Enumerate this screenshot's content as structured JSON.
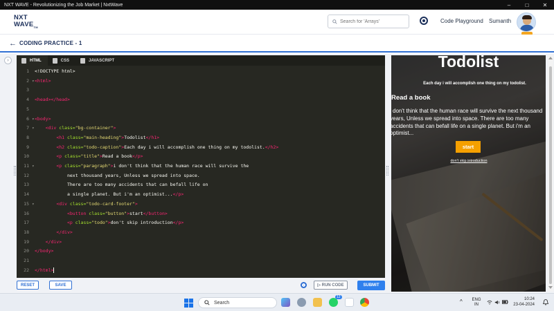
{
  "window": {
    "title": "NXT WAVE - Revolutionizing the Job Market | NxtWave",
    "controls": [
      "–",
      "□",
      "✕"
    ]
  },
  "nav": {
    "logo_line1": "NXT",
    "logo_line2": "WAVE",
    "logo_tm": "TM",
    "search_placeholder": "Search for 'Arrays'",
    "code_playground": "Code Playground",
    "user_name": "Sumanth"
  },
  "header": {
    "back": "←",
    "title": "CODING PRACTICE - 1"
  },
  "editor": {
    "tabs": [
      {
        "label": "HTML",
        "active": true
      },
      {
        "label": "CSS",
        "active": false
      },
      {
        "label": "JAVASCRIPT",
        "active": false
      }
    ],
    "lines": [
      {
        "n": "1",
        "fold": "",
        "html": "<span class=\"pl\">&lt;!DOCTYPE html&gt;</span>"
      },
      {
        "n": "2",
        "fold": "▾",
        "html": "<span class=\"tg\">&lt;html&gt;</span>"
      },
      {
        "n": "3",
        "fold": "",
        "html": ""
      },
      {
        "n": "4",
        "fold": "",
        "html": "<span class=\"tg\">&lt;head&gt;&lt;/head&gt;</span>"
      },
      {
        "n": "5",
        "fold": "",
        "html": ""
      },
      {
        "n": "6",
        "fold": "▾",
        "html": "<span class=\"tg\">&lt;body&gt;</span>"
      },
      {
        "n": "7",
        "fold": "▾",
        "html": "    <span class=\"tg\">&lt;div</span> <span class=\"at\">class=</span><span class=\"st\">\"bg-container\"</span><span class=\"tg\">&gt;</span>"
      },
      {
        "n": "8",
        "fold": "",
        "html": "        <span class=\"tg\">&lt;h1</span> <span class=\"at\">class=</span><span class=\"st\">\"main-heading\"</span><span class=\"tg\">&gt;</span><span class=\"tx\">Todolist</span><span class=\"tg\">&lt;/h1&gt;</span>"
      },
      {
        "n": "9",
        "fold": "",
        "html": "        <span class=\"tg\">&lt;h2</span> <span class=\"at\">class=</span><span class=\"st\">\"todo-caption\"</span><span class=\"tg\">&gt;</span><span class=\"tx\">Each day i will accomplish one thing on my todolist.</span><span class=\"tg\">&lt;/h2&gt;</span>"
      },
      {
        "n": "10",
        "fold": "",
        "html": "        <span class=\"tg\">&lt;p</span> <span class=\"at\">class=</span><span class=\"st\">\"title\"</span><span class=\"tg\">&gt;</span><span class=\"tx\">Read a book</span><span class=\"tg\">&lt;/p&gt;</span>"
      },
      {
        "n": "11",
        "fold": "▾",
        "html": "        <span class=\"tg\">&lt;p</span> <span class=\"at\">class=</span><span class=\"st\">\"paragraph\"</span><span class=\"tg\">&gt;</span><span class=\"tx\">i don't think that the human race will survive the</span>"
      },
      {
        "n": "12",
        "fold": "",
        "html": "            <span class=\"tx\">next thousand years, Unless we spread into space.</span>"
      },
      {
        "n": "13",
        "fold": "",
        "html": "            <span class=\"tx\">There are too many accidents that can befall life on</span>"
      },
      {
        "n": "14",
        "fold": "",
        "html": "            <span class=\"tx\">a single planet. But i'm an optimist...</span><span class=\"tg\">&lt;/p&gt;</span>"
      },
      {
        "n": "15",
        "fold": "▾",
        "html": "        <span class=\"tg\">&lt;div</span> <span class=\"at\">class=</span><span class=\"st\">\"todo-card-footer\"</span><span class=\"tg\">&gt;</span>"
      },
      {
        "n": "16",
        "fold": "",
        "html": "            <span class=\"tg\">&lt;button</span> <span class=\"at\">class=</span><span class=\"st\">\"button\"</span><span class=\"tg\">&gt;</span><span class=\"tx\">start</span><span class=\"tg\">&lt;/button&gt;</span>"
      },
      {
        "n": "17",
        "fold": "",
        "html": "            <span class=\"tg\">&lt;p</span> <span class=\"at\">class=</span><span class=\"st\">\"todo\"</span><span class=\"tg\">&gt;</span><span class=\"tx\">don't skip introduction</span><span class=\"tg\">&lt;/p&gt;</span>"
      },
      {
        "n": "18",
        "fold": "",
        "html": "        <span class=\"tg\">&lt;/div&gt;</span>"
      },
      {
        "n": "19",
        "fold": "",
        "html": "    <span class=\"tg\">&lt;/div&gt;</span>"
      },
      {
        "n": "20",
        "fold": "",
        "html": "<span class=\"tg\">&lt;/body&gt;</span>"
      },
      {
        "n": "21",
        "fold": "",
        "html": ""
      },
      {
        "n": "22",
        "fold": "",
        "html": "<span class=\"tg\">&lt;/html&gt;</span><span class=\"cursor\"></span>"
      }
    ]
  },
  "preview": {
    "heading": "Todolist",
    "caption": "Each day i will accomplish one thing on my todolist.",
    "title": "Read a book",
    "paragraph": "i don't think that the human race will survive the next thousand years, Unless we spread into space. There are too many accidents that can befall life on a single planet. But i'm an optimist...",
    "button": "start",
    "todo": "don't skip introduction"
  },
  "toolbar": {
    "reset": "RESET",
    "save": "SAVE",
    "run_code": "▷ RUN CODE",
    "submit": "SUBMIT"
  },
  "taskbar": {
    "search": "Search",
    "badge": "12",
    "lang_line1": "ENG",
    "lang_line2": "IN",
    "time": "10:24",
    "date": "23-04-2024",
    "tray_up": "^"
  },
  "colors": {
    "brand_blue": "#2f6fd3",
    "submit_blue": "#2f80ed",
    "editor_bg": "#272822",
    "start_button": "#f5a000"
  },
  "icons": [
    "back-arrow-icon",
    "search-icon",
    "streak-icon",
    "gear-icon",
    "windows-start-icon",
    "chrome-icon",
    "wifi-icon",
    "volume-icon",
    "battery-icon"
  ]
}
